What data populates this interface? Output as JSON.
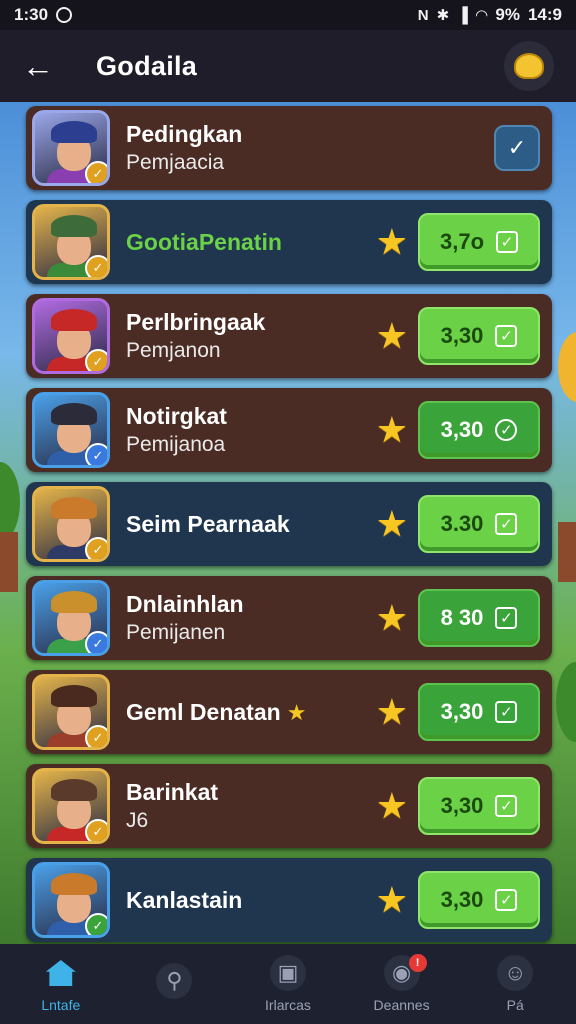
{
  "status_bar": {
    "time": "1:30",
    "battery": "9%",
    "clock_right": "14:9"
  },
  "header": {
    "title": "Godaila",
    "back_icon": "arrow-left-icon",
    "profile_icon": "profile-badge-icon"
  },
  "rows": [
    {
      "name": "Pedingkan",
      "sub": "Pemjaacia",
      "price": "",
      "style": "brown",
      "hat": "#2c3e8f",
      "shirt": "#8a3fb0",
      "frame": "#9aa7e8",
      "badge": "#e0a020",
      "action": "edit"
    },
    {
      "name": "GootiaPenatin",
      "sub": "",
      "price": "3,7o",
      "style": "blue",
      "hat": "#3d6b3a",
      "shirt": "#3a8a3a",
      "frame": "#e4b44a",
      "badge": "#e0a020",
      "action": "price",
      "name_color": "#6bd147"
    },
    {
      "name": "Perlbringaak",
      "sub": "Pemjanon",
      "price": "3,30",
      "style": "brown",
      "hat": "#c62828",
      "shirt": "#c62828",
      "frame": "#b06be0",
      "badge": "#e0a020",
      "action": "price"
    },
    {
      "name": "Notirgkat",
      "sub": "Pemijanoa",
      "price": "3,30",
      "style": "brown",
      "hat": "#2b2b3a",
      "shirt": "#2e5fa8",
      "frame": "#4aa0e8",
      "badge": "#3a7ae0",
      "action": "price",
      "dark": true,
      "round": true
    },
    {
      "name": "Seim Pearnaak",
      "sub": "",
      "price": "3.30",
      "style": "blue",
      "hat": "#c97a2b",
      "shirt": "#2d3b66",
      "frame": "#e4b44a",
      "badge": "#e0a020",
      "action": "price"
    },
    {
      "name": "Dnlainhlan",
      "sub": "Pemijanen",
      "price": "8 30",
      "style": "brown",
      "hat": "#c9902b",
      "shirt": "#3aa04a",
      "frame": "#4aa0e8",
      "badge": "#3a7ae0",
      "action": "price",
      "dark": true
    },
    {
      "name": "Geml Denatan",
      "sub": "",
      "price": "3,30",
      "style": "brown",
      "hat": "#4a2a1e",
      "shirt": "#9a3d2b",
      "frame": "#e4b44a",
      "badge": "#e0a020",
      "action": "price",
      "dark": true,
      "name_star": true
    },
    {
      "name": "Barinkat",
      "sub": "J6",
      "price": "3,30",
      "style": "brown",
      "hat": "#5a3a2a",
      "shirt": "#c62828",
      "frame": "#e4b44a",
      "badge": "#e0a020",
      "action": "price"
    },
    {
      "name": "Kanlastain",
      "sub": "",
      "price": "3,30",
      "style": "blue",
      "hat": "#c97a2b",
      "shirt": "#2e5fa8",
      "frame": "#4aa0e8",
      "badge": "#3aa33a",
      "action": "price"
    }
  ],
  "nav": [
    {
      "label": "Lntafe",
      "icon": "home-icon",
      "active": true
    },
    {
      "label": "",
      "icon": "search-icon"
    },
    {
      "label": "Irlarcas",
      "icon": "inventory-icon"
    },
    {
      "label": "Deannes",
      "icon": "notification-icon",
      "badge": "!"
    },
    {
      "label": "Pá",
      "icon": "user-icon"
    }
  ],
  "colors": {
    "accent_green": "#6bd147",
    "accent_blue": "#3fb3e8",
    "star": "#f7c623"
  }
}
